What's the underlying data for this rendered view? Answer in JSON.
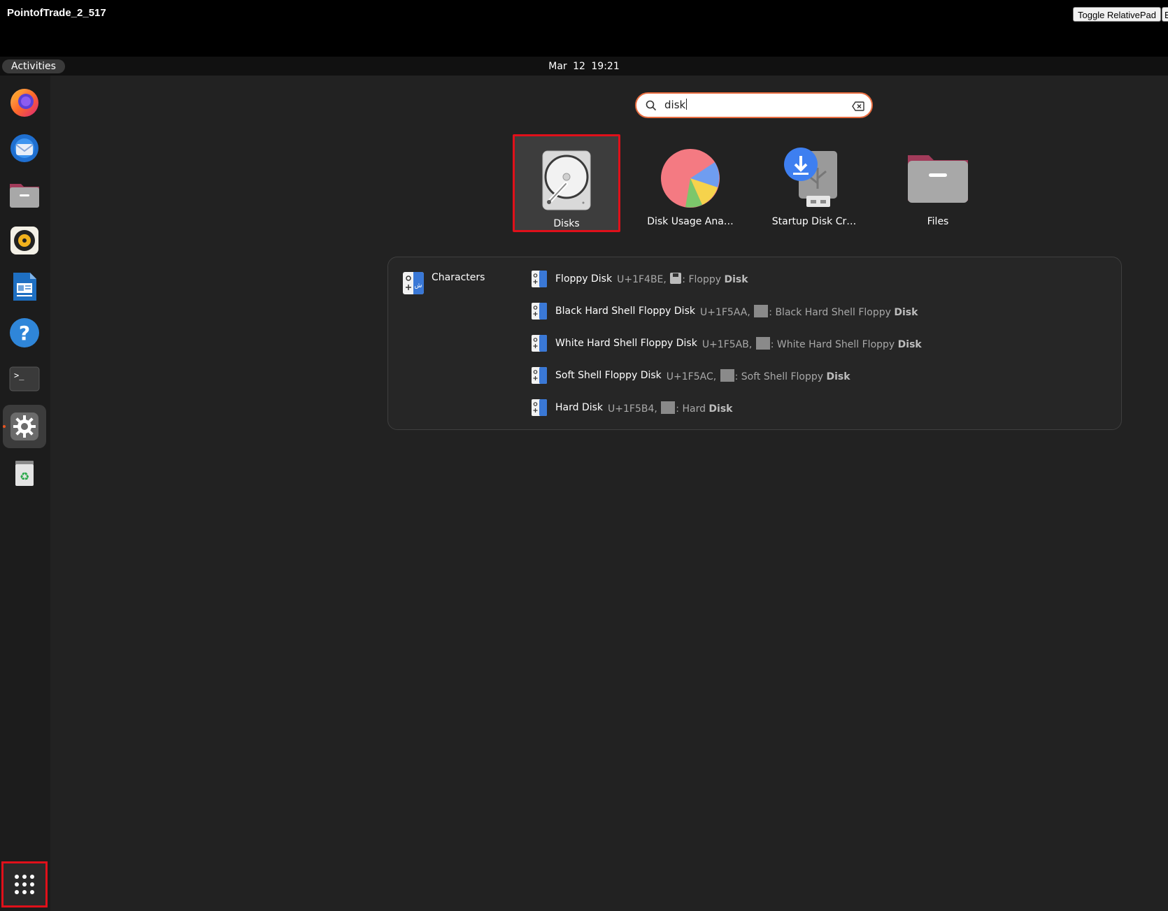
{
  "caption": {
    "title": "PointofTrade_2_517",
    "toggle_label": "Toggle RelativePad",
    "second_button_label": "E"
  },
  "topbar": {
    "activities": "Activities",
    "date": "Mar 12",
    "time": "19:21"
  },
  "dock": {
    "items": [
      {
        "name": "firefox-icon"
      },
      {
        "name": "thunderbird-icon"
      },
      {
        "name": "files-icon"
      },
      {
        "name": "rhythmbox-icon"
      },
      {
        "name": "writer-icon"
      },
      {
        "name": "help-icon"
      },
      {
        "name": "terminal-icon"
      },
      {
        "name": "settings-icon"
      },
      {
        "name": "trash-icon"
      }
    ],
    "show_apps_icon": "grid-icon"
  },
  "search": {
    "value": "disk",
    "icon": "search-icon",
    "clear_icon": "backspace-icon"
  },
  "apps": [
    {
      "label": "Disks",
      "icon": "disks-icon",
      "selected": true
    },
    {
      "label": "Disk Usage Ana…",
      "icon": "disk-usage-analyzer-icon",
      "selected": false
    },
    {
      "label": "Startup Disk Cr…",
      "icon": "startup-disk-creator-icon",
      "selected": false
    },
    {
      "label": "Files",
      "icon": "files-icon",
      "selected": false
    }
  ],
  "characters": {
    "provider": "Characters",
    "results": [
      {
        "name": "Floppy Disk",
        "code": "U+1F4BE,",
        "prefix": ": Floppy ",
        "match": "Disk"
      },
      {
        "name": "Black Hard Shell Floppy Disk",
        "code": "U+1F5AA,",
        "prefix": ": Black Hard Shell Floppy ",
        "match": "Disk"
      },
      {
        "name": "White Hard Shell Floppy Disk",
        "code": "U+1F5AB,",
        "prefix": ": White Hard Shell Floppy ",
        "match": "Disk"
      },
      {
        "name": "Soft Shell Floppy Disk",
        "code": "U+1F5AC,",
        "prefix": ": Soft Shell Floppy ",
        "match": "Disk"
      },
      {
        "name": "Hard Disk",
        "code": "U+1F5B4,",
        "prefix": ": Hard ",
        "match": "Disk"
      }
    ]
  },
  "colors": {
    "accent": "#e95420",
    "highlight_border": "#e0101a"
  }
}
